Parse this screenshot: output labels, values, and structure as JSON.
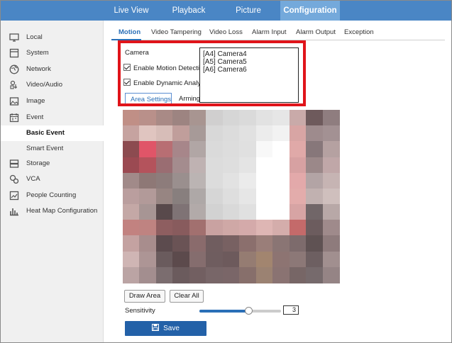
{
  "topnav": {
    "tabs": [
      {
        "label": "Live View"
      },
      {
        "label": "Playback"
      },
      {
        "label": "Picture"
      },
      {
        "label": "Configuration"
      }
    ]
  },
  "sidebar": {
    "items": [
      {
        "label": "Local",
        "icon": "monitor-icon"
      },
      {
        "label": "System",
        "icon": "system-icon"
      },
      {
        "label": "Network",
        "icon": "globe-icon"
      },
      {
        "label": "Video/Audio",
        "icon": "video-audio-icon"
      },
      {
        "label": "Image",
        "icon": "image-icon"
      },
      {
        "label": "Event",
        "icon": "calendar-icon"
      },
      {
        "label": "Basic Event"
      },
      {
        "label": "Smart Event"
      },
      {
        "label": "Storage",
        "icon": "storage-icon"
      },
      {
        "label": "VCA",
        "icon": "vca-icon"
      },
      {
        "label": "People Counting",
        "icon": "people-counting-icon"
      },
      {
        "label": "Heat Map Configuration",
        "icon": "bar-chart-icon"
      }
    ]
  },
  "subtabs": [
    {
      "label": "Motion"
    },
    {
      "label": "Video Tampering"
    },
    {
      "label": "Video Loss"
    },
    {
      "label": "Alarm Input"
    },
    {
      "label": "Alarm Output"
    },
    {
      "label": "Exception"
    }
  ],
  "camera": {
    "label": "Camera",
    "options": [
      "[A4] Camera4",
      "[A5] Camera5",
      "[A6] Camera6"
    ],
    "enable_motion": "Enable Motion Detection",
    "enable_dynamic": "Enable Dynamic Analysis"
  },
  "area_tabs": {
    "area_settings": "Area Settings",
    "arming": "Arming..."
  },
  "buttons": {
    "draw_area": "Draw Area",
    "clear_all": "Clear All",
    "save": "Save"
  },
  "sensitivity": {
    "label": "Sensitivity",
    "value": "3",
    "level_fraction": 0.6
  },
  "colors": {
    "nav_bg": "#4a86c5",
    "nav_active": "#74a9db",
    "accent": "#2a6fb7",
    "save_bg": "#2361a8",
    "highlight_red": "#e0141a"
  }
}
